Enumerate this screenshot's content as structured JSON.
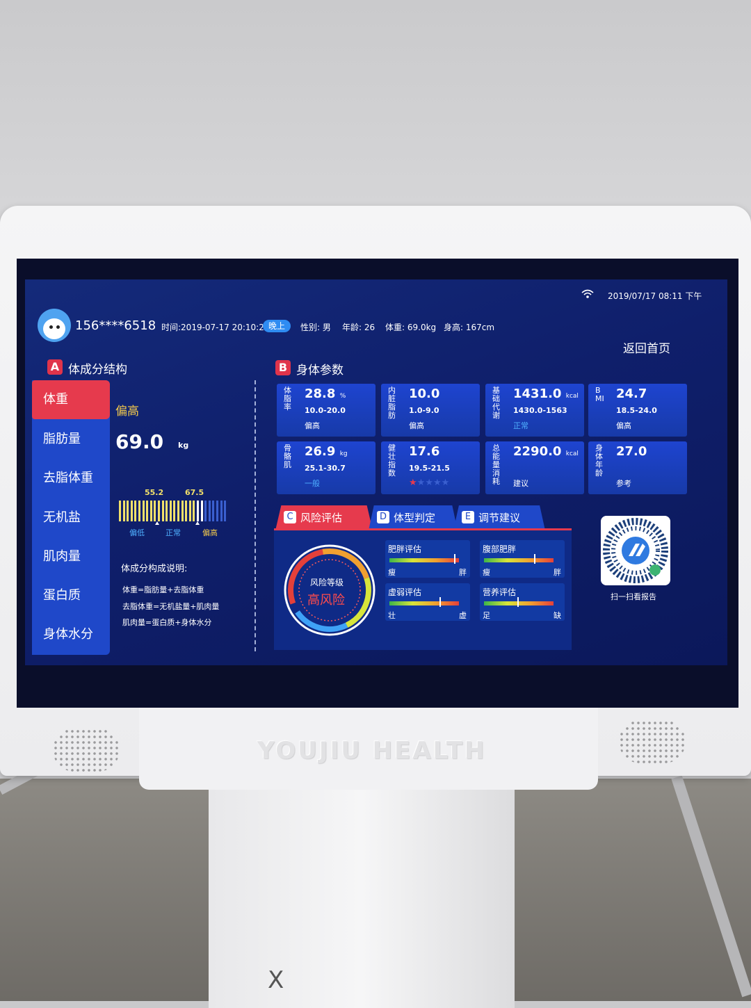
{
  "status_bar": {
    "datetime": "2019/07/17  08:11  下午"
  },
  "header": {
    "phone": "156****6518",
    "time": "时间:2019-07-17 20:10:23",
    "period_tag": "晚上",
    "gender": "性别: 男",
    "age": "年龄: 26",
    "weight": "体重: 69.0kg",
    "height": "身高: 167cm",
    "home_button": "返回首页"
  },
  "section_a": {
    "badge": "A",
    "title": "体成分结构",
    "nav": [
      "体重",
      "脂肪量",
      "去脂体重",
      "无机盐",
      "肌肉量",
      "蛋白质",
      "身体水分"
    ],
    "active_index": 0,
    "status": "偏高",
    "value": "69.0",
    "unit": "kg",
    "range_low": "55.2",
    "range_high": "67.5",
    "scale_labels": [
      "偏低",
      "正常",
      "偏高"
    ],
    "explain_title": "体成分构成说明:",
    "explain_lines": [
      "体重=脂肪量+去脂体重",
      "去脂体重=无机盐量+肌肉量",
      "肌肉量=蛋白质+身体水分"
    ]
  },
  "section_b": {
    "badge": "B",
    "title": "身体参数",
    "cards": [
      {
        "label": "体脂率",
        "value": "28.8",
        "unit": "%",
        "range": "10.0-20.0",
        "status": "偏高"
      },
      {
        "label": "内脏脂肪",
        "value": "10.0",
        "unit": "",
        "range": "1.0-9.0",
        "status": "偏高"
      },
      {
        "label": "基础代谢",
        "value": "1431.0",
        "unit": "kcal",
        "range": "1430.0-1563",
        "status": "正常"
      },
      {
        "label": "BMI",
        "value": "24.7",
        "unit": "",
        "range": "18.5-24.0",
        "status": "偏高"
      },
      {
        "label": "骨骼肌",
        "value": "26.9",
        "unit": "kg",
        "range": "25.1-30.7",
        "status": "一般"
      },
      {
        "label": "健壮指数",
        "value": "17.6",
        "unit": "",
        "range": "19.5-21.5",
        "status": "",
        "stars": 1,
        "stars_max": 5
      },
      {
        "label": "总能量消耗",
        "value": "2290.0",
        "unit": "kcal",
        "range": "",
        "status": "建议"
      },
      {
        "label": "身体年龄",
        "value": "27.0",
        "unit": "",
        "range": "",
        "status": "参考"
      }
    ]
  },
  "tabs": [
    {
      "letter": "C",
      "label": "风险评估"
    },
    {
      "letter": "D",
      "label": "体型判定"
    },
    {
      "letter": "E",
      "label": "调节建议"
    }
  ],
  "risk": {
    "gauge_title": "风险等级",
    "level": "高风险"
  },
  "evaluations": [
    {
      "title": "肥胖评估",
      "left": "瘦",
      "right": "胖",
      "position": 0.93
    },
    {
      "title": "腹部肥胖",
      "left": "瘦",
      "right": "胖",
      "position": 0.72
    },
    {
      "title": "虚弱评估",
      "left": "壮",
      "right": "虚",
      "position": 0.72
    },
    {
      "title": "营养评估",
      "left": "足",
      "right": "缺",
      "position": 0.48
    }
  ],
  "qr": {
    "caption": "扫一扫看报告"
  },
  "bezel": {
    "brand": "YOUJIU HEALTH"
  },
  "colors": {
    "accent_red": "#e63a4d",
    "panel_blue": "#1f48c9",
    "bg_blue": "#0f1f6b"
  }
}
